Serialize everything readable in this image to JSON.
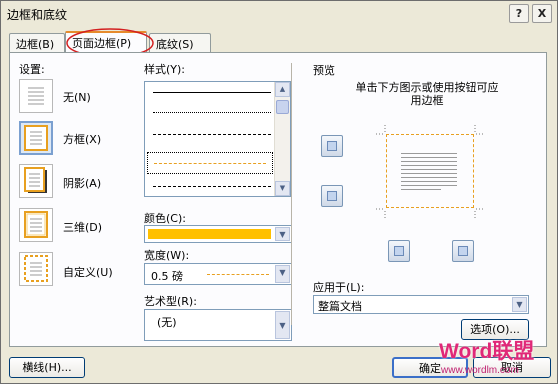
{
  "dialog": {
    "title": "边框和底纹",
    "help_label": "?",
    "close_label": "X"
  },
  "tabs": [
    {
      "label": "边框(B)"
    },
    {
      "label": "页面边框(P)"
    },
    {
      "label": "底纹(S)"
    }
  ],
  "settings": {
    "heading": "设置:",
    "items": [
      {
        "label": "无(N)"
      },
      {
        "label": "方框(X)"
      },
      {
        "label": "阴影(A)"
      },
      {
        "label": "三维(D)"
      },
      {
        "label": "自定义(U)"
      }
    ],
    "selected": "方框(X)"
  },
  "style": {
    "label": "样式(Y):"
  },
  "color": {
    "label": "颜色(C):",
    "value_hex": "#ffc000"
  },
  "width": {
    "label": "宽度(W):",
    "value": "0.5 磅"
  },
  "art": {
    "label": "艺术型(R):",
    "value": "(无)"
  },
  "preview": {
    "heading": "预览",
    "instructions": "单击下方图示或使用按钮可应用边框"
  },
  "apply": {
    "label": "应用于(L):",
    "value": "整篇文档"
  },
  "buttons": {
    "options": "选项(O)...",
    "horizontal_line": "横线(H)...",
    "ok": "确定",
    "cancel": "取消"
  },
  "watermark": {
    "brand": "Word联盟",
    "url": "www.wordlm.com"
  },
  "colors": {
    "accent": "#e8a020",
    "tab_highlight": "#e68b2c",
    "annotation_circle": "#d32020"
  }
}
